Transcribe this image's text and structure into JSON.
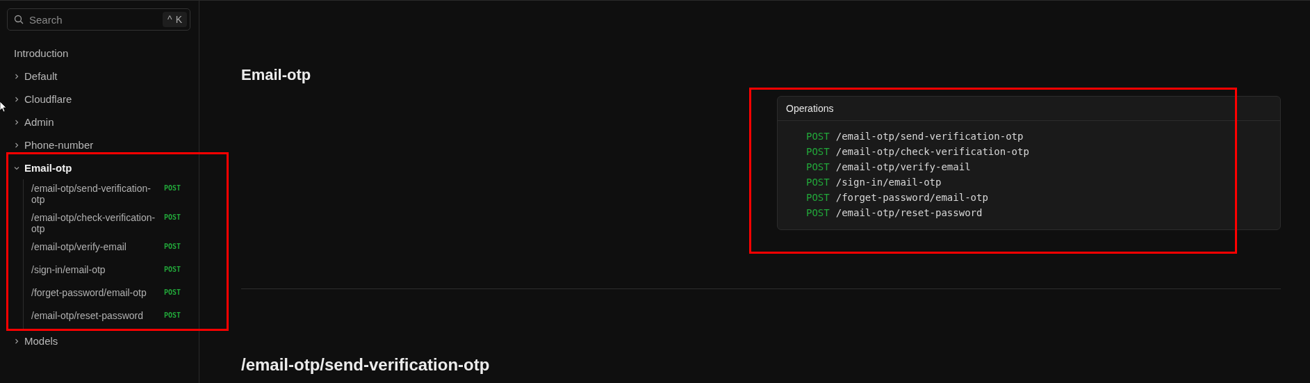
{
  "sidebar": {
    "search": {
      "placeholder": "Search",
      "shortcut": [
        "^",
        "K"
      ]
    },
    "nav": [
      {
        "kind": "link",
        "label": "Introduction"
      },
      {
        "kind": "group",
        "label": "Default",
        "expanded": false
      },
      {
        "kind": "group",
        "label": "Cloudflare",
        "expanded": false
      },
      {
        "kind": "group",
        "label": "Admin",
        "expanded": false
      },
      {
        "kind": "group",
        "label": "Phone-number",
        "expanded": false
      },
      {
        "kind": "group",
        "label": "Email-otp",
        "expanded": true,
        "highlighted": true,
        "children": [
          {
            "label": "/email-otp/send-verification-otp",
            "method": "POST"
          },
          {
            "label": "/email-otp/check-verification-otp",
            "method": "POST"
          },
          {
            "label": "/email-otp/verify-email",
            "method": "POST"
          },
          {
            "label": "/sign-in/email-otp",
            "method": "POST"
          },
          {
            "label": "/forget-password/email-otp",
            "method": "POST"
          },
          {
            "label": "/email-otp/reset-password",
            "method": "POST"
          }
        ]
      },
      {
        "kind": "group",
        "label": "Models",
        "expanded": false
      }
    ]
  },
  "main": {
    "title": "Email-otp",
    "operations": {
      "title": "Operations",
      "highlighted": true,
      "items": [
        {
          "method": "POST",
          "path": "/email-otp/send-verification-otp"
        },
        {
          "method": "POST",
          "path": "/email-otp/check-verification-otp"
        },
        {
          "method": "POST",
          "path": "/email-otp/verify-email"
        },
        {
          "method": "POST",
          "path": "/sign-in/email-otp"
        },
        {
          "method": "POST",
          "path": "/forget-password/email-otp"
        },
        {
          "method": "POST",
          "path": "/email-otp/reset-password"
        }
      ]
    },
    "next_heading": "/email-otp/send-verification-otp"
  }
}
